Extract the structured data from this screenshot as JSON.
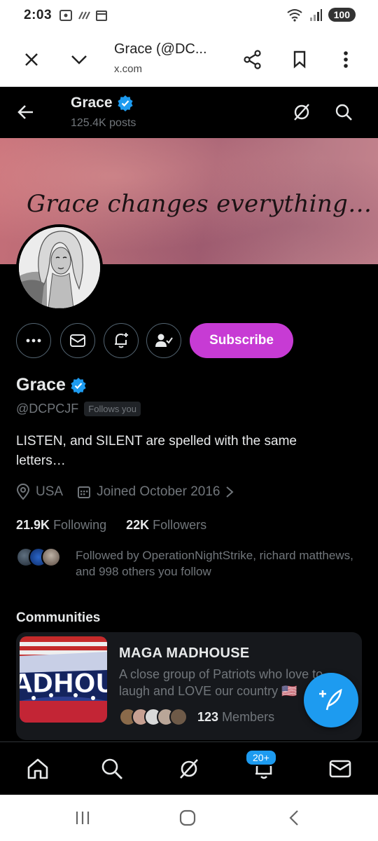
{
  "status_bar": {
    "time": "2:03",
    "battery": "100"
  },
  "browser": {
    "title": "Grace (@DC...",
    "url": "x.com"
  },
  "header": {
    "name": "Grace",
    "posts": "125.4K posts"
  },
  "banner": {
    "text": "Grace changes everything…"
  },
  "actions": {
    "subscribe": "Subscribe"
  },
  "profile": {
    "name": "Grace",
    "handle": "@DCPCJF",
    "follows_you": "Follows you",
    "bio": "LISTEN, and SILENT are spelled with the same letters…",
    "location": "USA",
    "joined": "Joined October 2016",
    "following_count": "21.9K",
    "following_label": "Following",
    "followers_count": "22K",
    "followers_label": "Followers",
    "followed_by": "Followed by OperationNightStrike, richard matthews, and 998 others you follow"
  },
  "communities": {
    "title": "Communities",
    "items": [
      {
        "name": "MAGA MADHOUSE",
        "description": "A close group of Patriots who love to laugh and LOVE our country 🇺🇸",
        "member_count": "123",
        "member_label": "Members",
        "image_text": "ADHOUS"
      }
    ]
  },
  "bottom_nav": {
    "notifications_badge": "20+"
  },
  "colors": {
    "accent": "#1d9bf0",
    "subscribe": "#c73bd4",
    "background": "#000000"
  }
}
